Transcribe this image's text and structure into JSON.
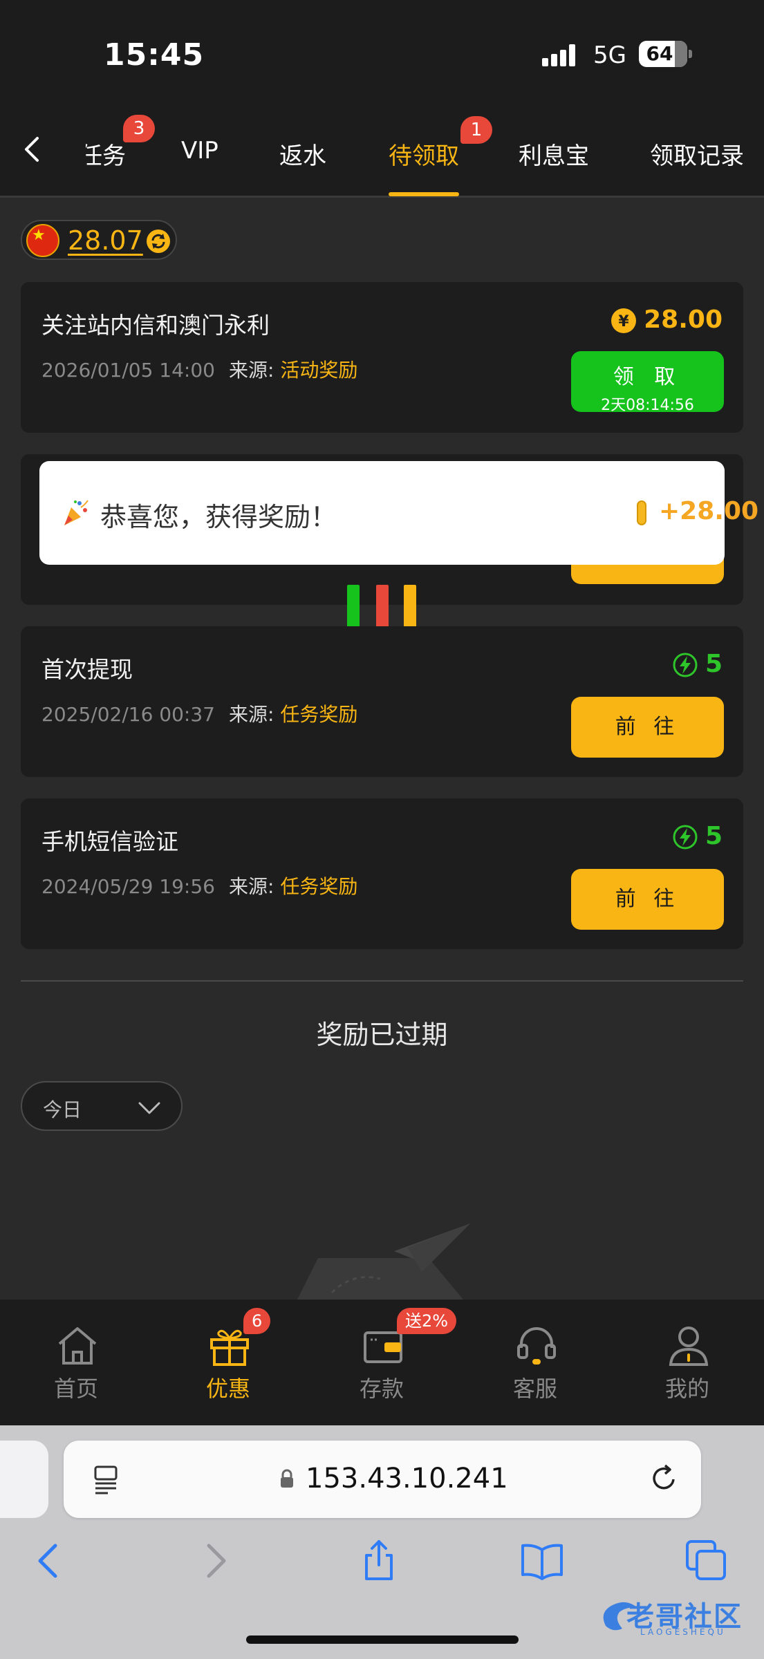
{
  "status_bar": {
    "time": "15:45",
    "network": "5G",
    "battery": "64",
    "battery_level_percent": 64
  },
  "tabs": [
    {
      "label": "任务",
      "badge": "3",
      "active": false
    },
    {
      "label": "VIP",
      "active": false
    },
    {
      "label": "返水",
      "active": false
    },
    {
      "label": "待领取",
      "badge": "1",
      "active": true
    },
    {
      "label": "利息宝",
      "active": false
    },
    {
      "label": "领取记录",
      "active": false
    }
  ],
  "balance": {
    "amount": "28.07"
  },
  "cards": [
    {
      "title": "关注站内信和澳门永利",
      "date": "2026/01/05 14:00",
      "source_label": "来源:",
      "source": "活动奖励",
      "reward": "28.00",
      "reward_icon": "yuan-coin-icon",
      "button_label": "领 取",
      "button_sub": "2天08:14:56"
    },
    {
      "title": "首次提现",
      "date": "2025/02/16 00:37",
      "source_label": "来源:",
      "source": "任务奖励",
      "reward": "5",
      "reward_icon": "lightning-icon",
      "button_label": "前 往"
    },
    {
      "title": "手机短信验证",
      "date": "2024/05/29 19:56",
      "source_label": "来源:",
      "source": "任务奖励",
      "reward": "5",
      "reward_icon": "lightning-icon",
      "button_label": "前 往"
    }
  ],
  "toast": {
    "text": "恭喜您，获得奖励！",
    "amount": "+28.00",
    "icon": "party-popper-icon"
  },
  "expired": {
    "title": "奖励已过期",
    "filter_value": "今日"
  },
  "bottom_nav": [
    {
      "label": "首页",
      "icon": "home-icon",
      "active": false
    },
    {
      "label": "优惠",
      "icon": "gift-icon",
      "badge": "6",
      "active": true
    },
    {
      "label": "存款",
      "icon": "wallet-icon",
      "badge": "送2%",
      "active": false
    },
    {
      "label": "客服",
      "icon": "headset-icon",
      "active": false
    },
    {
      "label": "我的",
      "icon": "user-icon",
      "active": false
    }
  ],
  "browser": {
    "url": "153.43.10.241"
  },
  "watermark": {
    "text": "老哥社区",
    "sub": "LAOGESHEQU"
  },
  "colors": {
    "accent": "#f8b514",
    "claim_green": "#16c21c",
    "badge_red": "#e8483a",
    "reward_green": "#2ec52a"
  }
}
